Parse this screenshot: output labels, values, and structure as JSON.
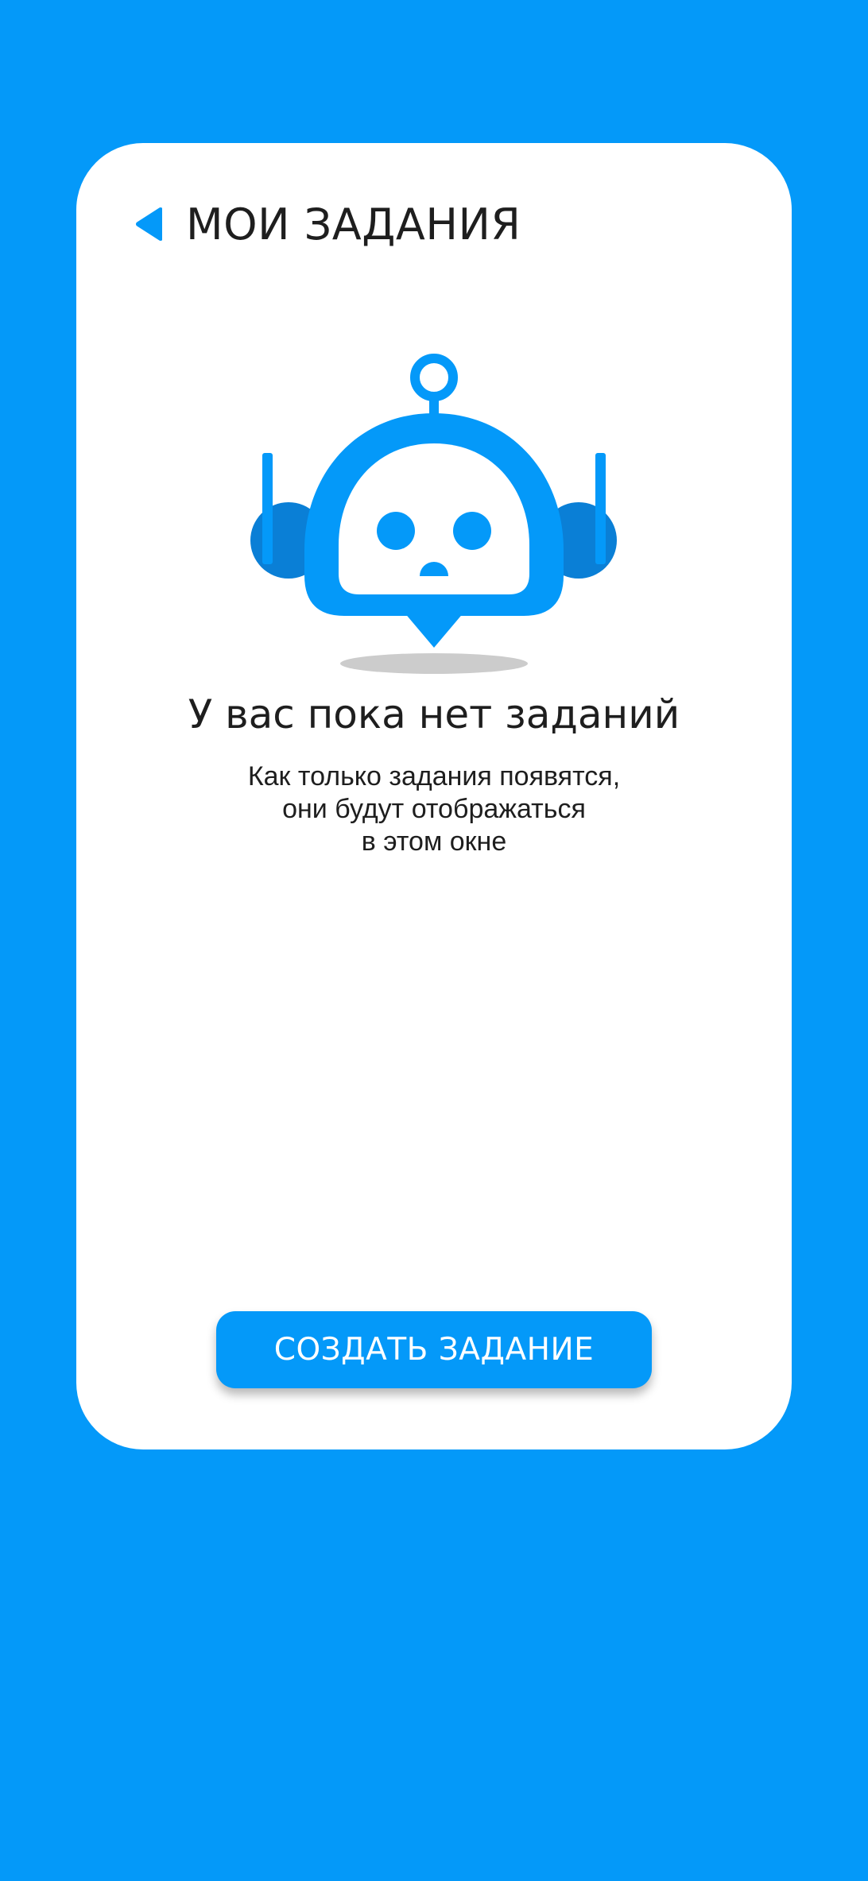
{
  "colors": {
    "background": "#0499f9",
    "card": "#ffffff",
    "accent": "#0499f9",
    "accent_dark": "#0a7fd6",
    "text": "#1e1e1e",
    "shadow": "#cccccc"
  },
  "header": {
    "back_icon": "back-triangle-icon",
    "title": "МОИ ЗАДАНИЯ"
  },
  "illustration": {
    "icon": "robot-chat-icon"
  },
  "empty_state": {
    "title": "У вас пока нет заданий",
    "subtitle_lines": [
      "Как только задания появятся,",
      "они будут отображаться",
      "в этом окне"
    ]
  },
  "actions": {
    "create_label": "СОЗДАТЬ ЗАДАНИЕ"
  }
}
